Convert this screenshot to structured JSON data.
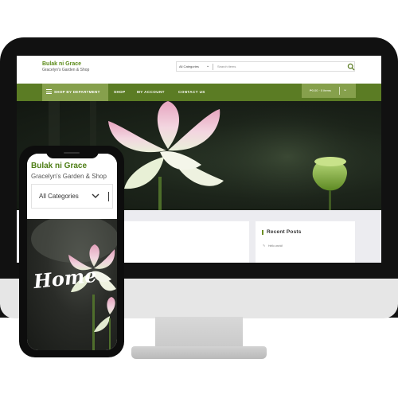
{
  "desktop": {
    "site_title": "Bulak ni Grace",
    "site_tagline": "Gracelyn's Garden & Shop",
    "search": {
      "category": "All Categories",
      "placeholder": "Search items"
    },
    "nav": {
      "department": "SHOP BY DEPARTMENT",
      "links": [
        "SHOP",
        "MY ACCOUNT",
        "CONTACT US"
      ],
      "cart": "₱0.00 · 0 items"
    },
    "sidebar": {
      "widget_title": "Recent Posts",
      "items": [
        "Hello world!"
      ]
    }
  },
  "mobile": {
    "site_title": "Bulak ni Grace",
    "site_tagline": "Gracelyn's Garden & Shop",
    "category_select": "All Categories",
    "hero_text": "Home"
  },
  "colors": {
    "brand_green": "#5b7c24",
    "accent_green": "#86a04c",
    "title_green": "#5a8a17"
  },
  "icons": [
    "search-icon",
    "hamburger-icon",
    "chevron-down-icon",
    "pin-icon"
  ]
}
